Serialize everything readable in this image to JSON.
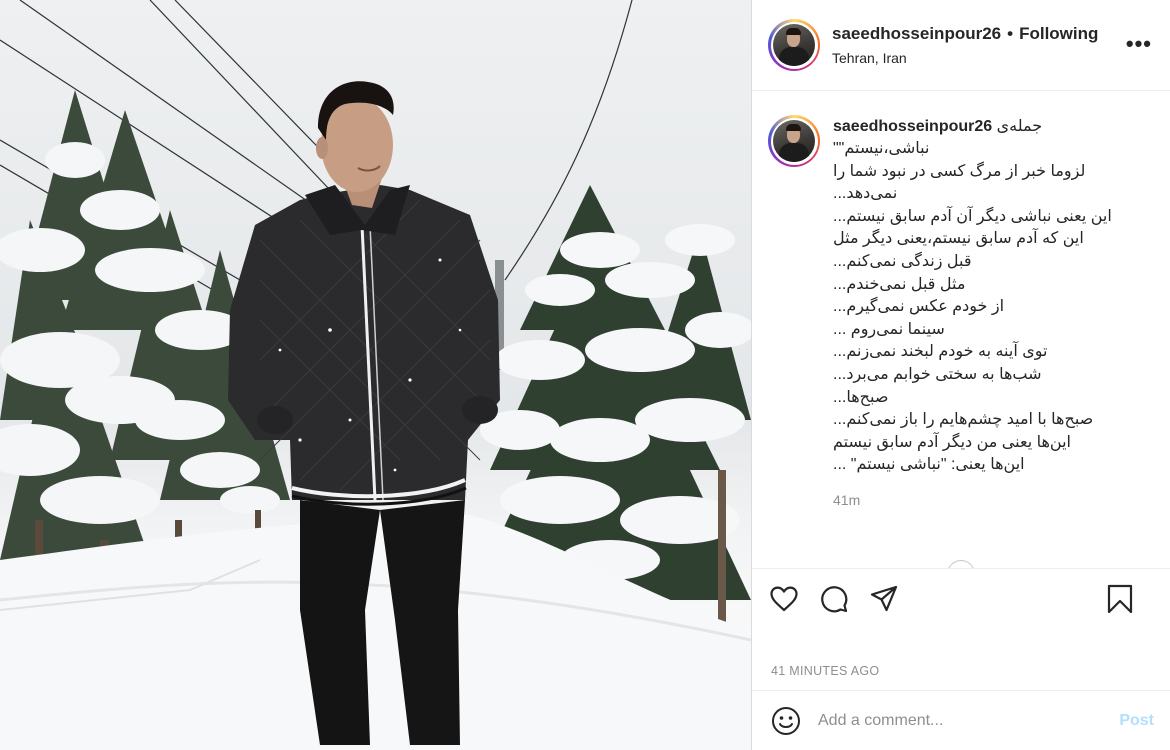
{
  "post": {
    "image_alt": "Man in black jacket standing in snow among snow-covered pine trees",
    "author": {
      "username": "saeedhosseinpour26",
      "separator": "•",
      "follow_status": "Following",
      "location": "Tehran, Iran"
    },
    "more_label": "•••",
    "caption": {
      "username": "saeedhosseinpour26",
      "first_line": "جمله‌ی",
      "lines": [
        "\"\"نباشی،نیستم",
        "لزوما خبر از مرگ کسی در نبود شما را",
        "...نمی‌دهد",
        "...این یعنی نباشی دیگر آن آدم سابق نیستم",
        "این که آدم سابق نیستم،یعنی دیگر مثل",
        "...قبل زندگی نمی‌کنم",
        "...مثل قبل نمی‌خندم",
        "...از خودم عکس نمی‌گیرم",
        "... سینما نمی‌روم",
        "...توی آینه به خودم لبخند نمی‌زنم",
        "...شب‌ها به سختی خوابم می‌برد",
        "...صبح‌ها",
        "...صبح‌ها با امید چشم‌هایم را باز نمی‌کنم",
        "این‌ها یعنی من دیگر آدم سابق نیستم",
        "... \"این‌ها یعنی: \"نباشی نیستم"
      ],
      "time_ago": "41m"
    },
    "timestamp": "41 MINUTES AGO",
    "comment_box": {
      "placeholder": "Add a comment...",
      "post_label": "Post"
    }
  },
  "colors": {
    "post_button_disabled": "#b2dffc",
    "secondary_text": "#8e8e8e",
    "primary_text": "#262626",
    "border": "#dbdbdb"
  },
  "icons": [
    "heart-icon",
    "comment-icon",
    "share-icon",
    "bookmark-icon",
    "emoji-icon",
    "more-options-icon"
  ]
}
